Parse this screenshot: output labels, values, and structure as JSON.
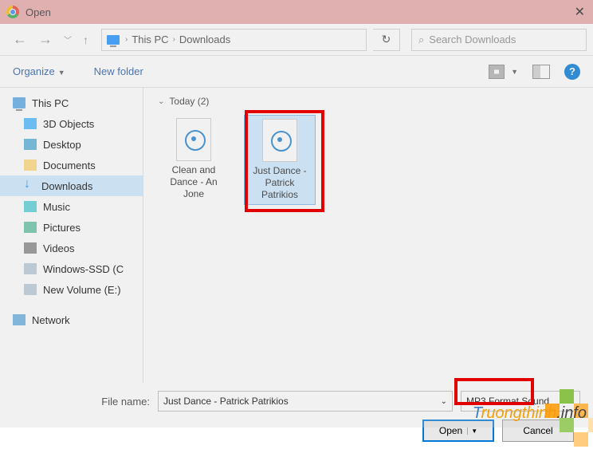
{
  "titlebar": {
    "title": "Open",
    "close": "✕"
  },
  "nav": {
    "breadcrumb": {
      "item1": "This PC",
      "item2": "Downloads"
    },
    "search_placeholder": "Search Downloads",
    "refresh": "↻"
  },
  "toolbar": {
    "organize": "Organize",
    "new_folder": "New folder",
    "help": "?"
  },
  "sidebar": {
    "this_pc": "This PC",
    "items": [
      {
        "label": "3D Objects"
      },
      {
        "label": "Desktop"
      },
      {
        "label": "Documents"
      },
      {
        "label": "Downloads"
      },
      {
        "label": "Music"
      },
      {
        "label": "Pictures"
      },
      {
        "label": "Videos"
      },
      {
        "label": "Windows-SSD (C"
      },
      {
        "label": "New Volume (E:)"
      }
    ],
    "network": "Network"
  },
  "content": {
    "group": "Today (2)",
    "files": [
      {
        "name": "Clean and Dance - An Jone"
      },
      {
        "name": "Just Dance - Patrick Patrikios"
      }
    ]
  },
  "footer": {
    "filename_label": "File name:",
    "filename_value": "Just Dance - Patrick Patrikios",
    "filetype_value": "MP3 Format Sound",
    "open": "Open",
    "cancel": "Cancel"
  },
  "watermark": {
    "t1": "T",
    "t2": "ruongthinh",
    "t3": ".info"
  }
}
